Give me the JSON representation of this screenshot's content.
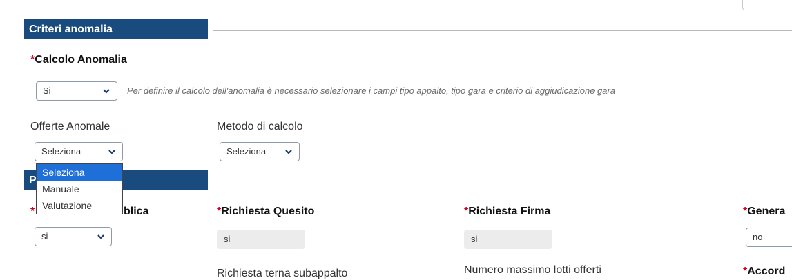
{
  "criteria_section": {
    "title": "Criteri anomalia"
  },
  "calcolo_anomalia": {
    "label": "Calcolo Anomalia",
    "value": "Si",
    "note": "Per definire il calcolo dell'anomalia è necessario selezionare i campi tipo appalto, tipo gara e criterio di aggiudicazione gara"
  },
  "offerte_anomale": {
    "label": "Offerte Anomale",
    "value": "Seleziona",
    "options": [
      "Seleziona",
      "Manuale",
      "Valutazione"
    ]
  },
  "metodo_calcolo": {
    "label": "Metodo di calcolo",
    "value": "Seleziona"
  },
  "second_section": {
    "title_visible": "P"
  },
  "fields_row1": {
    "f1": {
      "label_partial": "blica",
      "value": "si"
    },
    "richiesta_quesito": {
      "label": "Richiesta Quesito",
      "value": "si"
    },
    "richiesta_firma": {
      "label": "Richiesta Firma",
      "value": "si"
    },
    "genera": {
      "label": "Genera",
      "value": "no"
    }
  },
  "fields_row2": {
    "richiesta_terna": {
      "label": "Richiesta terna subappalto"
    },
    "numero_massimo": {
      "label": "Numero massimo lotti offerti"
    },
    "accord": {
      "label": "Accord"
    }
  },
  "required_mark": "*",
  "colors": {
    "header_bg": "#1a4b7f",
    "required": "#d6001c",
    "option_selected": "#1f6fd8"
  }
}
